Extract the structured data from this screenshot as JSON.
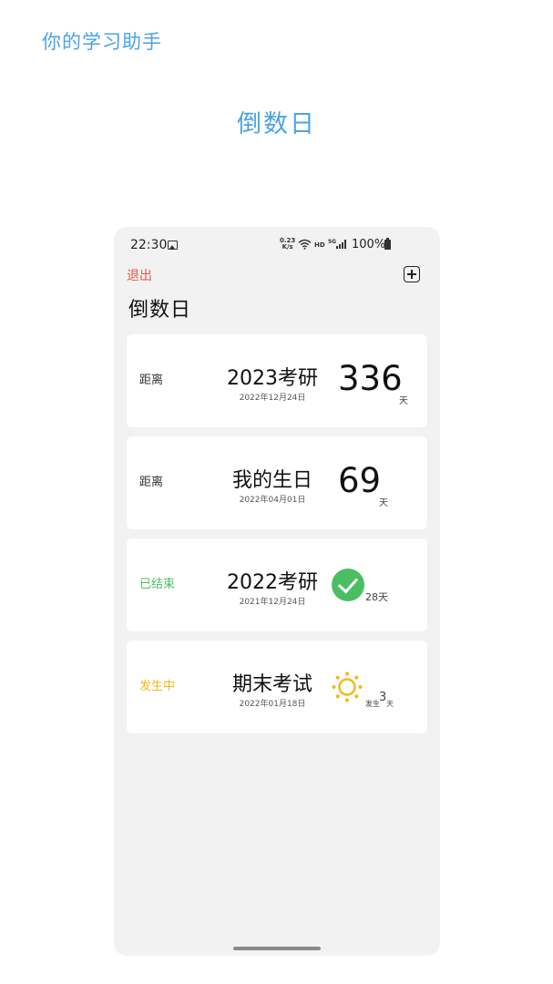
{
  "app": {
    "brand": "你的学习助手",
    "headline": "倒数日"
  },
  "statusbar": {
    "time": "22:30",
    "net_speed_value": "0.23",
    "net_speed_unit": "K/s",
    "hd": "HD",
    "network": "5G",
    "battery": "100%"
  },
  "toolbar": {
    "exit_label": "退出",
    "title": "倒数日"
  },
  "cards": [
    {
      "status": "距离",
      "name": "2023考研",
      "date": "2022年12月24日",
      "count": "336",
      "unit": "天"
    },
    {
      "status": "距离",
      "name": "我的生日",
      "date": "2022年04月01日",
      "count": "69",
      "unit": "天"
    },
    {
      "status": "已结束",
      "name": "2022考研",
      "date": "2021年12月24日",
      "days_text": "28天"
    },
    {
      "status": "发生中",
      "name": "期末考试",
      "date": "2022年01月18日",
      "prefix": "发生",
      "count": "3",
      "unit": "天"
    }
  ],
  "colors": {
    "accent_blue": "#4aa3e6",
    "exit_red": "#e25a4a",
    "ended_green": "#4cbe62",
    "ongoing_yellow": "#f2b81e"
  },
  "icons": [
    "gallery-icon",
    "wifi-icon",
    "signal-icon",
    "battery-icon",
    "add-icon",
    "check-icon",
    "sun-icon"
  ]
}
